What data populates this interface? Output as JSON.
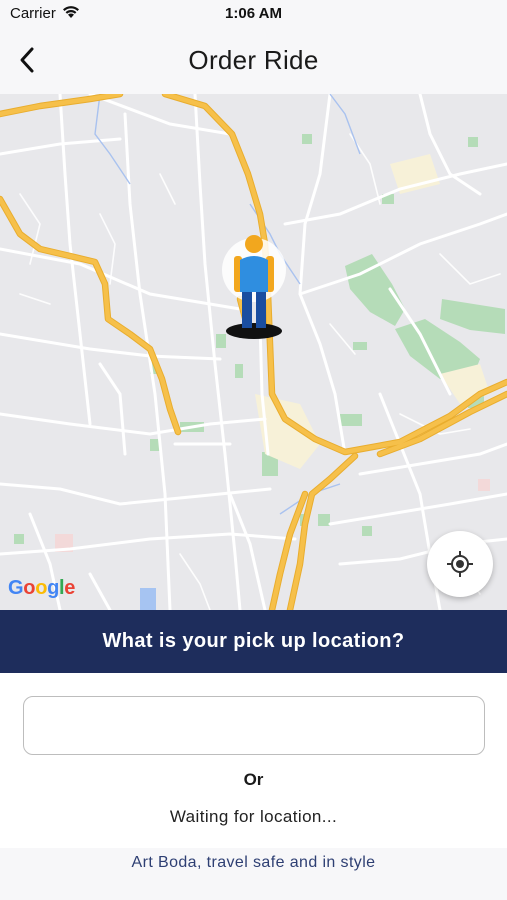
{
  "status_bar": {
    "carrier": "Carrier",
    "time": "1:06 AM",
    "wifi_icon": "wifi-icon"
  },
  "nav": {
    "title": "Order Ride",
    "back_icon": "chevron-left-icon"
  },
  "map": {
    "logo_text": "Google",
    "marker_icon": "person-icon",
    "locate_icon": "crosshair-icon",
    "colors": {
      "background": "#e8e8eb",
      "major_road": "#f6c04a",
      "minor_road": "#ffffff",
      "park": "#b5dcb8",
      "water": "#a6c4f2"
    }
  },
  "pickup": {
    "prompt": "What is your pick up location?",
    "input_value": "",
    "input_placeholder": ""
  },
  "alternatives": {
    "or_label": "Or",
    "status": "Waiting for location..."
  },
  "footer": {
    "tagline": "Art Boda, travel safe and in style"
  },
  "colors": {
    "banner": "#1e2d5c",
    "footer_text": "#2e3f73",
    "bar_background": "#f7f7f9"
  }
}
